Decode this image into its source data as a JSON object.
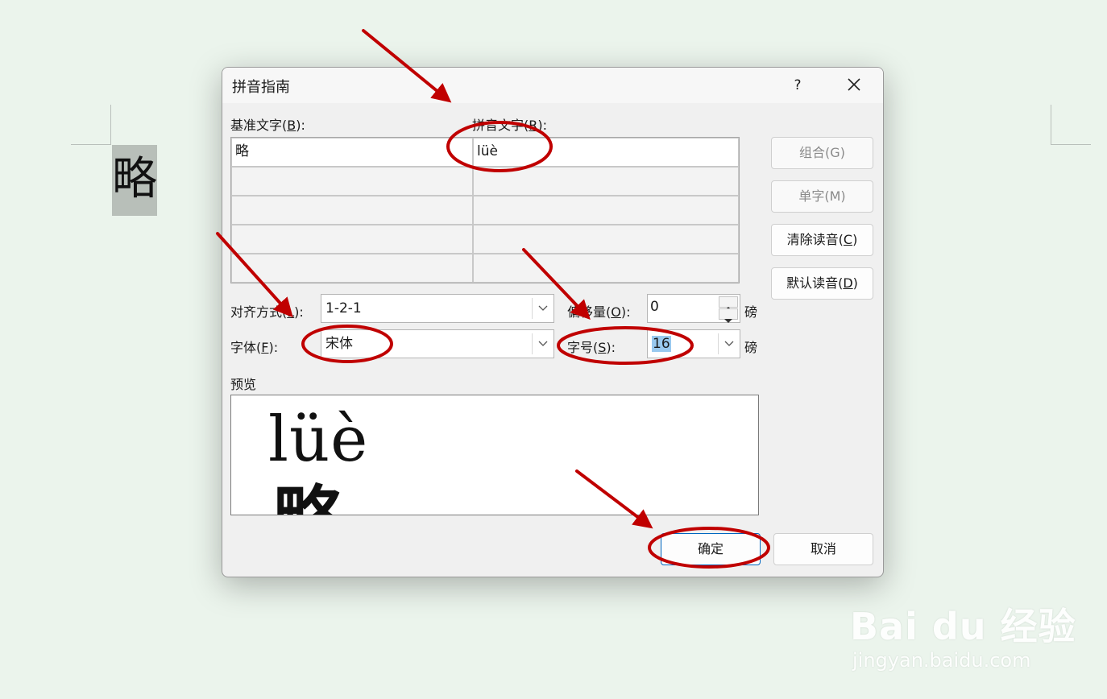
{
  "document": {
    "base_char": "略"
  },
  "dialog": {
    "title": "拼音指南",
    "help_label": "?",
    "base_text_label": {
      "text": "基准文字(",
      "key": "B",
      "suffix": "):"
    },
    "ruby_text_label": {
      "text": "拼音文字(",
      "key": "R",
      "suffix": "):"
    },
    "rows": [
      {
        "base": "略",
        "ruby": "lüè"
      },
      {
        "base": "",
        "ruby": ""
      },
      {
        "base": "",
        "ruby": ""
      },
      {
        "base": "",
        "ruby": ""
      },
      {
        "base": "",
        "ruby": ""
      }
    ],
    "alignment_label": {
      "text": "对齐方式(",
      "key": "L",
      "suffix": "):"
    },
    "alignment_value": "1-2-1",
    "offset_label": {
      "text": "偏移量(",
      "key": "O",
      "suffix": "):"
    },
    "offset_value": "0",
    "offset_unit": "磅",
    "font_label": {
      "text": "字体(",
      "key": "F",
      "suffix": "):"
    },
    "font_value": "宋体",
    "size_label": {
      "text": "字号(",
      "key": "S",
      "suffix": "):"
    },
    "size_value": "16",
    "size_unit": "磅",
    "preview_label": "预览",
    "preview_ruby": "lüè",
    "preview_base": "略",
    "buttons": {
      "group": "组合(G)",
      "mono": "单字(M)",
      "clear": {
        "text": "清除读音(",
        "key": "C",
        "suffix": ")"
      },
      "default": {
        "text": "默认读音(",
        "key": "D",
        "suffix": ")"
      },
      "ok": "确定",
      "cancel": "取消"
    }
  },
  "annotation_color": "#c00000",
  "watermark": {
    "brand": "Bai du 经验",
    "url": "jingyan.baidu.com"
  }
}
